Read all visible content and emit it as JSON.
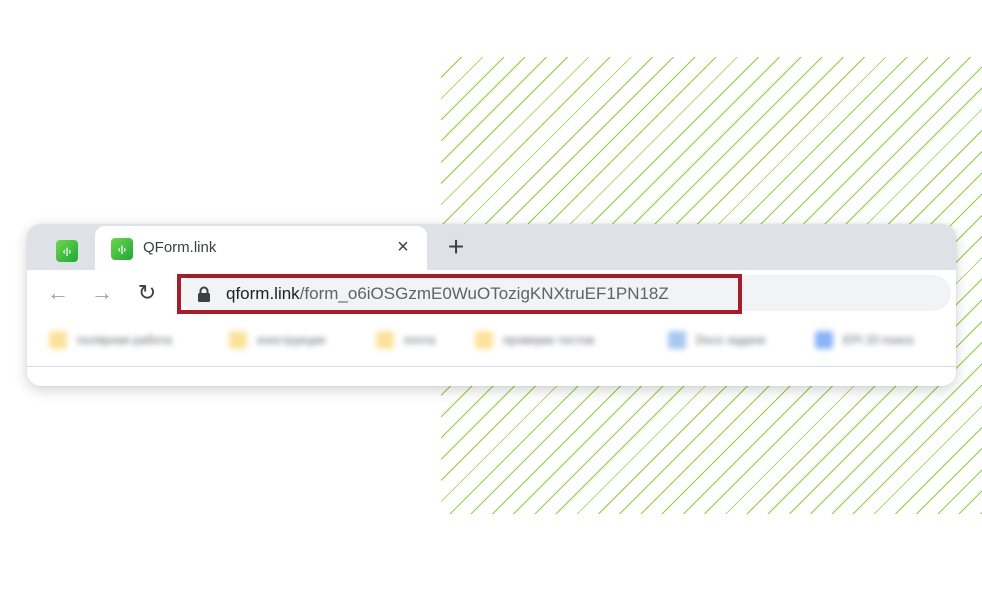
{
  "tab": {
    "title": "QForm.link",
    "close_glyph": "×",
    "favicon_glyph": "‹|›",
    "favicon_color": "#3cbf45"
  },
  "newtab_glyph": "+",
  "nav": {
    "back_glyph": "←",
    "forward_glyph": "→",
    "reload_glyph": "↻"
  },
  "address": {
    "domain": "qform.link",
    "path": "/form_o6iOSGzmE0WuOTozigKNXtruEF1PN18Z",
    "highlight_color": "#a51c2a"
  },
  "bookmarks": [
    {
      "label": "полярная работа",
      "color": "#fbe29a"
    },
    {
      "label": "конструкции",
      "color": "#fbe29a"
    },
    {
      "label": "почта",
      "color": "#fbe29a"
    },
    {
      "label": "проверки тестов",
      "color": "#fbe29a"
    },
    {
      "label": "Docs задачи",
      "color": "#a8c7f0"
    },
    {
      "label": "EPI 20 поиск",
      "color": "#8ab4f8"
    }
  ]
}
